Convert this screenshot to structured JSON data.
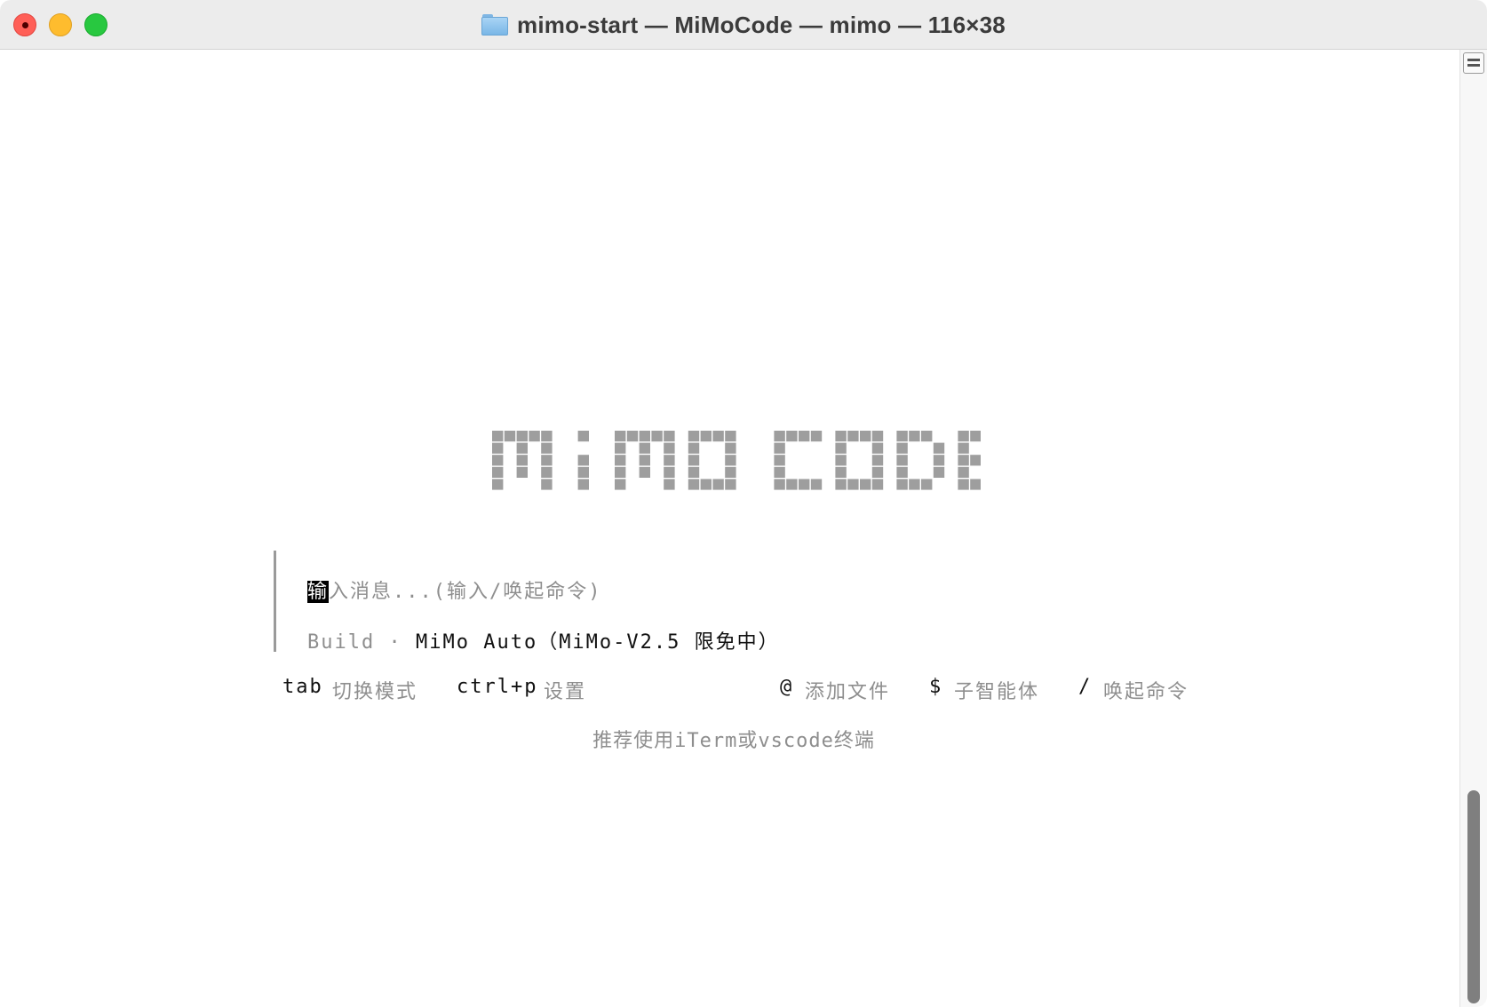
{
  "window": {
    "title": "mimo-start — MiMoCode — mimo — 116×38"
  },
  "logo": {
    "text": "MIMO CODE",
    "color": "#9e9e9e"
  },
  "prompt": {
    "cursor_char": "输",
    "placeholder_rest": "入消息...(输入/唤起命令)"
  },
  "mode": {
    "name": "Build",
    "separator": "·",
    "model": "MiMo Auto（MiMo-V2.5 限免中）"
  },
  "hints": {
    "tab_key": "tab",
    "tab_desc": "切换模式",
    "settings_key": "ctrl+p",
    "settings_desc": "设置",
    "file_key": "@",
    "file_desc": "添加文件",
    "agent_key": "$",
    "agent_desc": "子智能体",
    "command_key": "/",
    "command_desc": "唤起命令"
  },
  "tip": "推荐使用iTerm或vscode终端"
}
